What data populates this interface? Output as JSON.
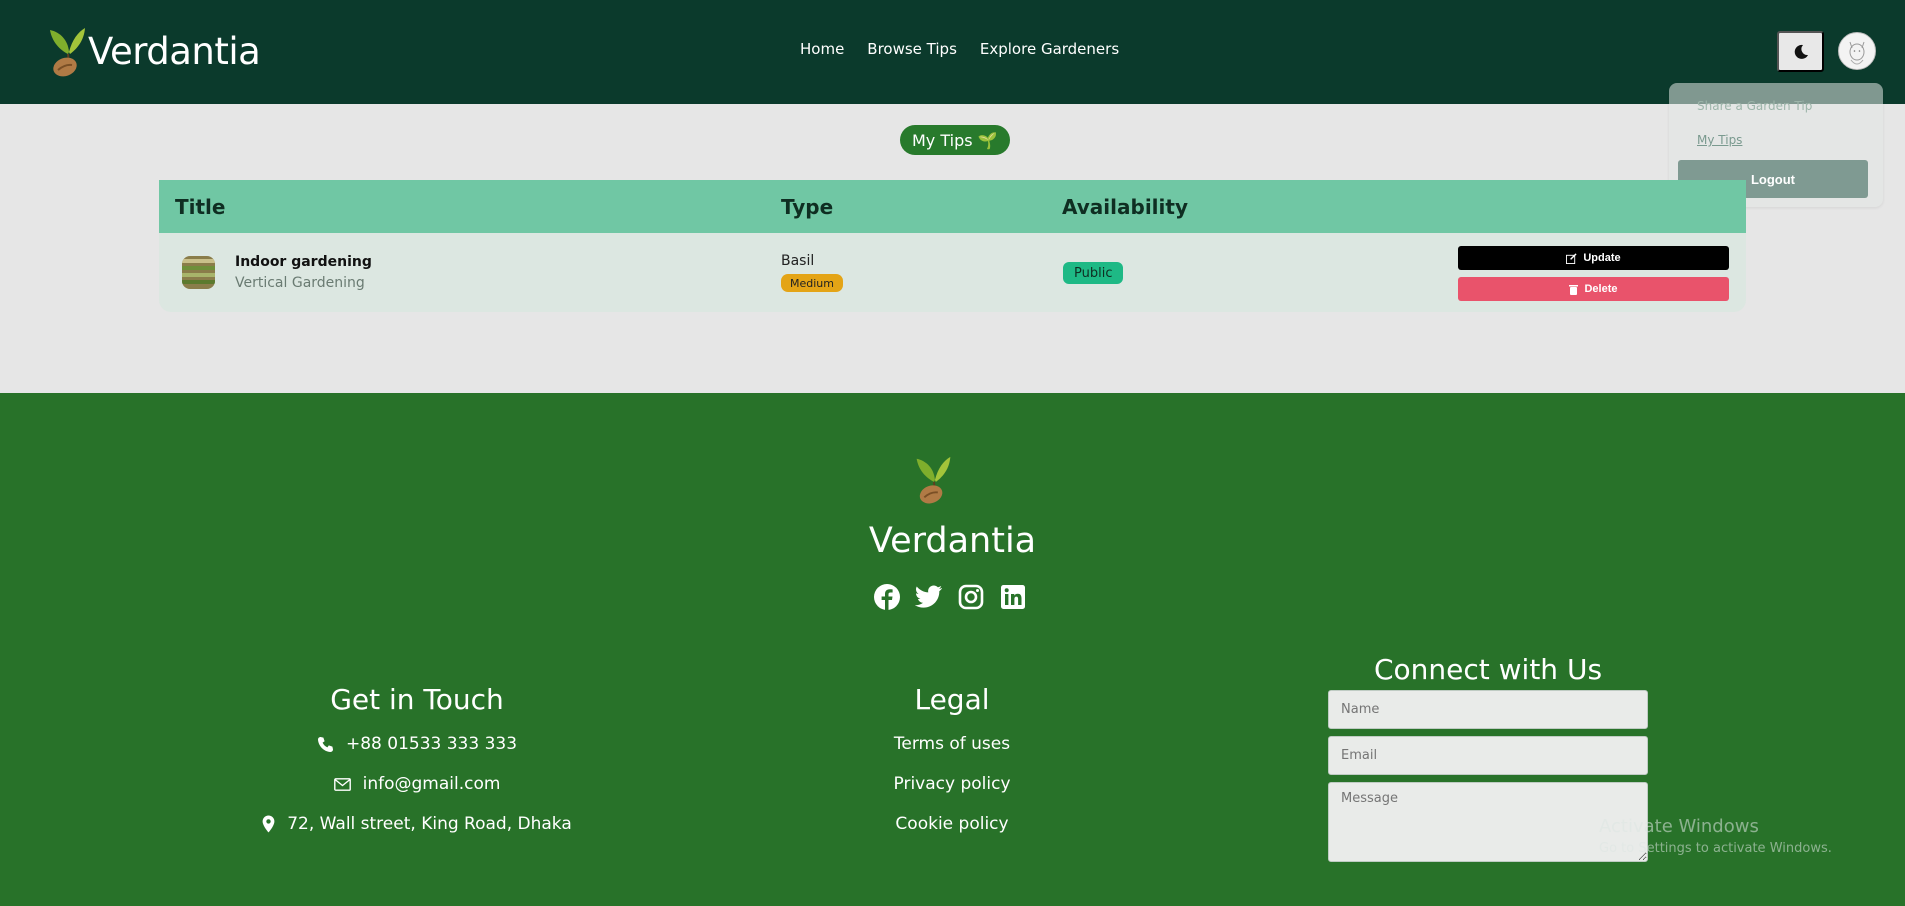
{
  "navbar": {
    "brand": "Verdantia",
    "links": [
      "Home",
      "Browse Tips",
      "Explore Gardeners"
    ]
  },
  "dropdown": {
    "share": "Share a Garden Tip",
    "my_tips": "My Tips",
    "logout": "Logout"
  },
  "page": {
    "badge": "My Tips 🌱"
  },
  "table": {
    "headers": [
      "Title",
      "Type",
      "Availability"
    ],
    "rows": [
      {
        "title": "Indoor gardening",
        "category": "Vertical Gardening",
        "plant": "Basil",
        "difficulty": "Medium",
        "availability": "Public",
        "update_label": "Update",
        "delete_label": "Delete"
      }
    ]
  },
  "footer": {
    "brand": "Verdantia",
    "socials": [
      "facebook-icon",
      "twitter-icon",
      "instagram-icon",
      "linkedin-icon"
    ],
    "touch": {
      "title": "Get in Touch",
      "phone": "+88 01533 333 333",
      "email": "info@gmail.com",
      "address": "72, Wall street, King Road, Dhaka"
    },
    "legal": {
      "title": "Legal",
      "links": [
        "Terms of uses",
        "Privacy policy",
        "Cookie policy"
      ]
    },
    "connect": {
      "title": "Connect with Us",
      "name_placeholder": "Name",
      "email_placeholder": "Email",
      "message_placeholder": "Message"
    }
  },
  "watermark": {
    "title": "Activate Windows",
    "subtitle": "Go to Settings to activate Windows."
  },
  "colors": {
    "navbar": "#0b3a2c",
    "footer": "#287229",
    "table_header": "#70c7a4",
    "public_badge": "#1eb985",
    "medium_badge": "#e4a416",
    "delete": "#e9536b"
  }
}
